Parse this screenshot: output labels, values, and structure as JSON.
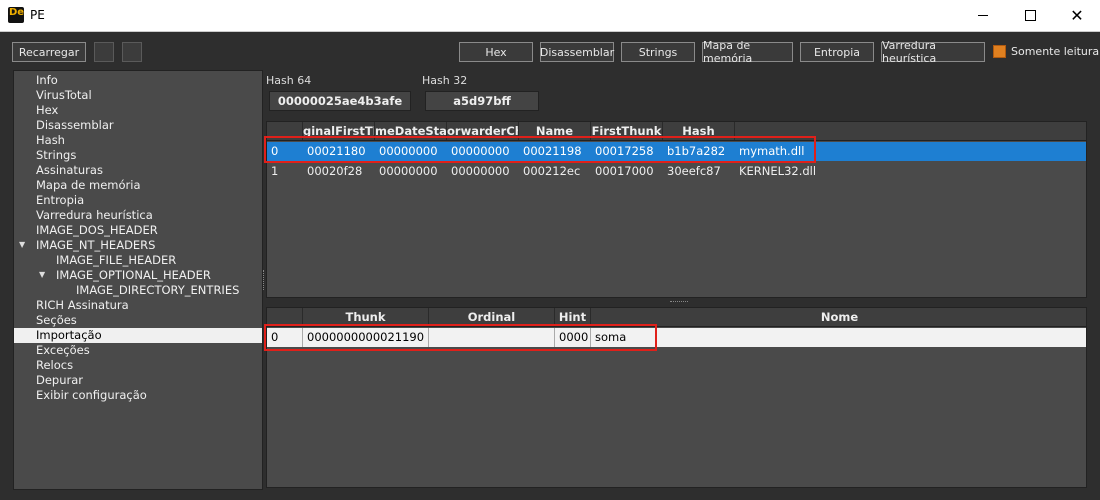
{
  "window": {
    "title": "PE",
    "icon_letters": "De"
  },
  "window_controls": {
    "minimize": "minimize-icon",
    "maximize": "maximize-icon",
    "close": "close-icon"
  },
  "toolbar": {
    "reload_label": "Recarregar",
    "buttons": [
      "Hex",
      "Disassemblar",
      "Strings",
      "Mapa de memória",
      "Entropia",
      "Varredura heurística"
    ],
    "readonly_label": "Somente leitura",
    "accent": "#e08020"
  },
  "sidebar": {
    "items": [
      "Info",
      "VirusTotal",
      "Hex",
      "Disassemblar",
      "Hash",
      "Strings",
      "Assinaturas",
      "Mapa de memória",
      "Entropia",
      "Varredura heurística",
      "IMAGE_DOS_HEADER",
      "IMAGE_NT_HEADERS",
      "IMAGE_FILE_HEADER",
      "IMAGE_OPTIONAL_HEADER",
      "IMAGE_DIRECTORY_ENTRIES",
      "RICH Assinatura",
      "Seções",
      "Importação",
      "Exceções",
      "Relocs",
      "Depurar",
      "Exibir configuração"
    ],
    "selected": "Importação"
  },
  "hash": {
    "hash64_label": "Hash 64",
    "hash64_value": "00000025ae4b3afe",
    "hash32_label": "Hash 32",
    "hash32_value": "a5d97bff"
  },
  "imports_table": {
    "columns": [
      "",
      "ginalFirstThu",
      "meDateStan",
      "orwarderCha",
      "Name",
      "FirstThunk",
      "Hash",
      ""
    ],
    "rows": [
      [
        "0",
        "00021180",
        "00000000",
        "00000000",
        "00021198",
        "00017258",
        "b1b7a282",
        "mymath.dll"
      ],
      [
        "1",
        "00020f28",
        "00000000",
        "00000000",
        "000212ec",
        "00017000",
        "30eefc87",
        "KERNEL32.dll"
      ]
    ],
    "selected_row": 0,
    "selection_color": "#1e7fd2"
  },
  "functions_table": {
    "columns": [
      "",
      "Thunk",
      "Ordinal",
      "Hint",
      "Nome"
    ],
    "rows": [
      [
        "0",
        "0000000000021190",
        "",
        "0000",
        "soma"
      ]
    ]
  },
  "highlight_color": "#e0201a"
}
